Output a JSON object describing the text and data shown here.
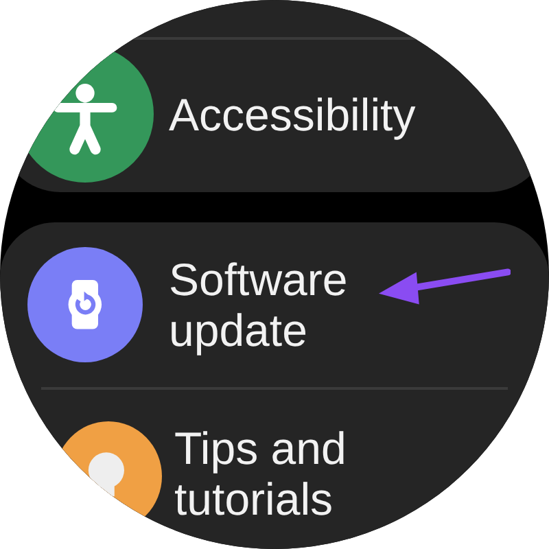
{
  "groups": [
    {
      "items": [
        {
          "label": "Accessibility",
          "kind": "accessibility",
          "color": "#34975a"
        }
      ]
    },
    {
      "items": [
        {
          "label": "Software update",
          "kind": "update",
          "color": "#7a7ef6"
        },
        {
          "label": "Tips and tutorials",
          "kind": "tips",
          "color": "#f0a044"
        }
      ]
    }
  ]
}
